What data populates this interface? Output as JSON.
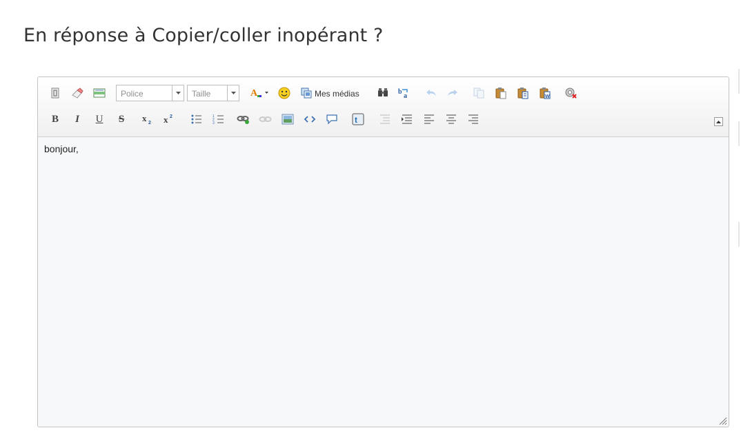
{
  "page": {
    "title": "En réponse à Copier/coller inopérant ?"
  },
  "editor": {
    "toolbar": {
      "font_select": {
        "value": "Police"
      },
      "size_select": {
        "value": "Taille"
      },
      "media_label": "Mes médias",
      "icons_row1": [
        "source-icon",
        "eraser-icon",
        "template-icon",
        "text-color-icon",
        "smiley-icon",
        "media-icon",
        "find-icon",
        "replace-icon",
        "undo-icon",
        "redo-icon",
        "copy-icon",
        "paste-icon",
        "paste-text-icon",
        "paste-word-icon",
        "spellcheck-icon"
      ],
      "icons_row2": [
        "bold-icon",
        "italic-icon",
        "underline-icon",
        "strike-icon",
        "subscript-icon",
        "superscript-icon",
        "bullet-list-icon",
        "number-list-icon",
        "link-icon",
        "unlink-icon",
        "image-icon",
        "code-icon",
        "quote-icon",
        "twitter-icon",
        "outdent-icon",
        "indent-icon",
        "align-left-icon",
        "align-center-icon",
        "align-right-icon"
      ]
    },
    "content": "bonjour,"
  }
}
